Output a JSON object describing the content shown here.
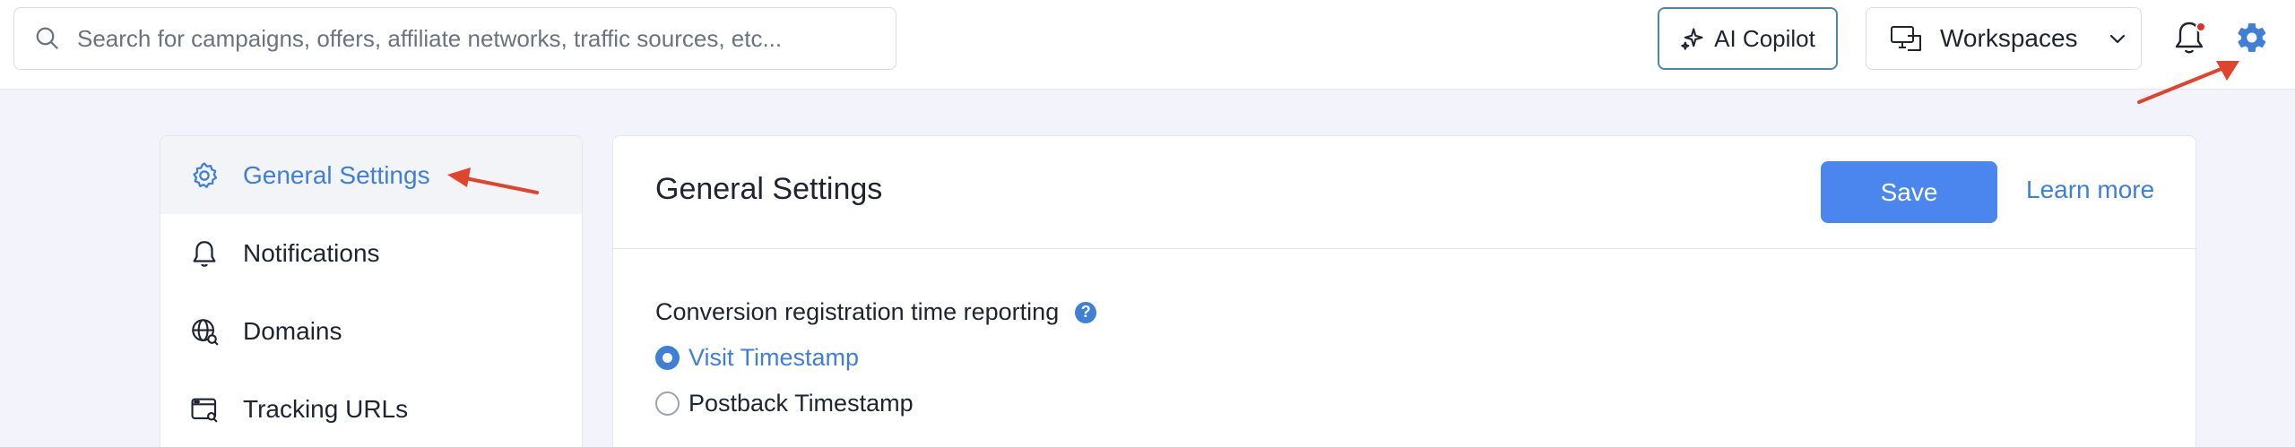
{
  "topbar": {
    "search_placeholder": "Search for campaigns, offers, affiliate networks, traffic sources, etc...",
    "copilot_label": "AI Copilot",
    "workspaces_label": "Workspaces"
  },
  "sidebar": {
    "items": [
      {
        "label": "General Settings",
        "icon": "gear-outline-icon",
        "active": true
      },
      {
        "label": "Notifications",
        "icon": "bell-icon",
        "active": false
      },
      {
        "label": "Domains",
        "icon": "globe-search-icon",
        "active": false
      },
      {
        "label": "Tracking URLs",
        "icon": "browser-search-icon",
        "active": false
      }
    ]
  },
  "main": {
    "title": "General Settings",
    "save_label": "Save",
    "learn_more_label": "Learn more",
    "section": {
      "label": "Conversion registration time reporting",
      "help_label": "?",
      "options": [
        {
          "label": "Visit Timestamp",
          "checked": true
        },
        {
          "label": "Postback Timestamp",
          "checked": false
        }
      ]
    }
  },
  "colors": {
    "accent": "#3f7fd6",
    "save_button": "#4a86ee",
    "annotation_arrow": "#e0442c",
    "background": "#f3f4fb"
  }
}
